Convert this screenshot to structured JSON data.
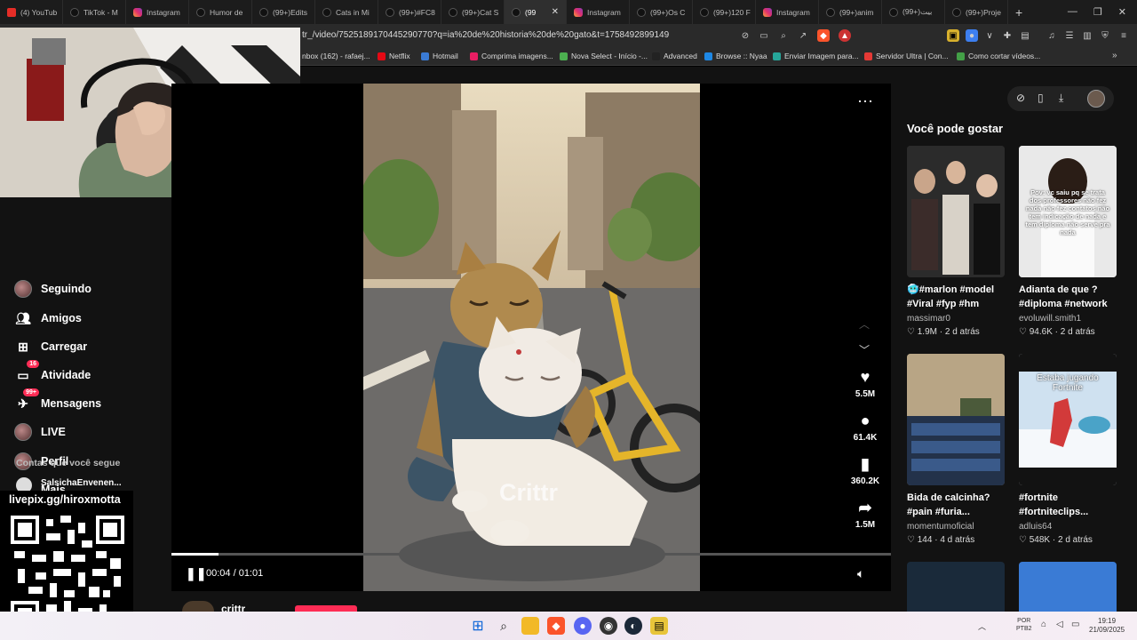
{
  "tabs": [
    {
      "label": "(4) YouTub",
      "icon": "youtube-icon"
    },
    {
      "label": "TikTok - M",
      "icon": "tiktok-icon"
    },
    {
      "label": "Instagram",
      "icon": "instagram-icon"
    },
    {
      "label": "Humor de",
      "icon": "tiktok-icon"
    },
    {
      "label": "(99+)Edits",
      "icon": "tiktok-icon"
    },
    {
      "label": "Cats in Mi",
      "icon": "tiktok-icon"
    },
    {
      "label": "(99+)#FC8",
      "icon": "tiktok-icon"
    },
    {
      "label": "(99+)Cat S",
      "icon": "tiktok-icon"
    },
    {
      "label": "(99",
      "icon": "tiktok-icon",
      "active": true
    },
    {
      "label": "Instagram",
      "icon": "instagram-icon"
    },
    {
      "label": "(99+)Os C",
      "icon": "tiktok-icon"
    },
    {
      "label": "(99+)120 F",
      "icon": "tiktok-icon"
    },
    {
      "label": "Instagram",
      "icon": "instagram-icon"
    },
    {
      "label": "(99+)anim",
      "icon": "tiktok-icon"
    },
    {
      "label": "(99+)بيت",
      "icon": "tiktok-icon"
    },
    {
      "label": "(99+)Proje",
      "icon": "tiktok-icon"
    }
  ],
  "url": "tr_/video/7525189170445290770?q=ia%20de%20historia%20de%20gato&t=1758492899149",
  "bookmarks": [
    {
      "label": "nbox (162) - rafaej...",
      "color": "#888888"
    },
    {
      "label": "Netflix",
      "color": "#e50914"
    },
    {
      "label": "Hotmail",
      "color": "#3a7bd5"
    },
    {
      "label": "Comprima imagens...",
      "color": "#e91e63"
    },
    {
      "label": "Nova Select - Início -...",
      "color": "#4caf50"
    },
    {
      "label": "Advanced",
      "color": "#222222"
    },
    {
      "label": "Browse :: Nyaa",
      "color": "#1e88e5"
    },
    {
      "label": "Enviar Imagem para...",
      "color": "#26a69a"
    },
    {
      "label": "Servidor Ultra | Con...",
      "color": "#e53935"
    },
    {
      "label": "Como cortar vídeos...",
      "color": "#43a047"
    }
  ],
  "sidebar": {
    "items": [
      {
        "label": "Seguindo",
        "icon": "avatar"
      },
      {
        "label": "Amigos",
        "icon": "friends-icon"
      },
      {
        "label": "Carregar",
        "icon": "upload-icon"
      },
      {
        "label": "Atividade",
        "icon": "activity-icon",
        "badge": "16"
      },
      {
        "label": "Mensagens",
        "icon": "messages-icon",
        "badge": "99+"
      },
      {
        "label": "LIVE",
        "icon": "live-icon"
      },
      {
        "label": "Perfil",
        "icon": "profile-avatar"
      },
      {
        "label": "Mais",
        "icon": "more-icon"
      }
    ],
    "following_header": "Contas que você segue",
    "following_first": "SalsichaEnvenen..."
  },
  "overlay": {
    "livepix": "livepix.gg/hiroxmotta"
  },
  "video": {
    "watermark": "Crittr",
    "time": "00:04 / 01:01",
    "progress_fraction": 0.066,
    "author": "crittr"
  },
  "actions": {
    "likes": "5.5M",
    "comments": "61.4K",
    "saves": "360.2K",
    "shares": "1.5M"
  },
  "suggestions": {
    "title": "Você pode gostar",
    "items": [
      {
        "caption_line1": "🥶#marlon #model",
        "caption_line2": "#Viral #fyp #hm",
        "author": "massimar0",
        "stats": "♡ 1.9M · 2 d atrás"
      },
      {
        "caption_line1": "Adianta de que ?",
        "caption_line2": "#diploma #network",
        "author": "evoluwill.smith1",
        "stats": "♡ 94.6K · 2 d atrás",
        "thumb_text": "Pov: vc saiu pq se trata dos professores não fez nada não fez contatos não tem indicação de nada e tem diploma não serve pra nada"
      },
      {
        "caption_line1": "Bida de calcinha?",
        "caption_line2": "#pain #furia...",
        "author": "momentumoficial",
        "stats": "♡ 144 · 4 d atrás"
      },
      {
        "caption_line1": "#fortnite",
        "caption_line2": "#fortniteclips...",
        "author": "adluis64",
        "stats": "♡ 548K · 2 d atrás",
        "thumb_text": "Estaba jugando Fortnite"
      }
    ]
  },
  "taskbar": {
    "lang_line1": "POR",
    "lang_line2": "PTB2",
    "time": "19:19",
    "date": "21/09/2025"
  }
}
